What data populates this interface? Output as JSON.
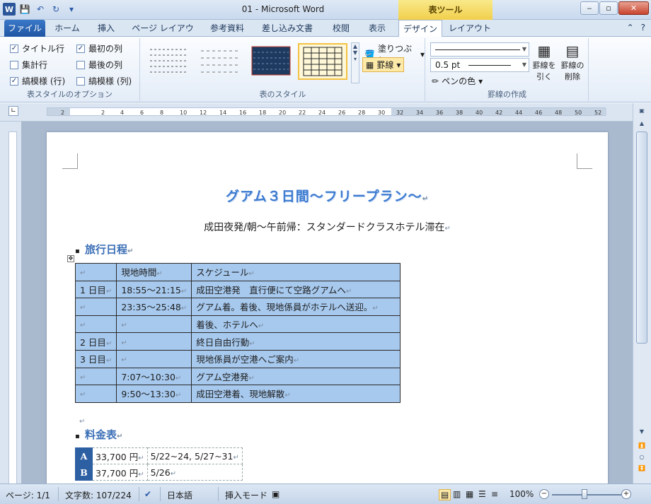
{
  "window": {
    "title": "01 - Microsoft Word",
    "contextual_tab": "表ツール",
    "controls": {
      "minimize": "‒",
      "restore": "▫",
      "close": "✕"
    }
  },
  "qat": {
    "word_logo": "W",
    "icons": [
      "save-icon",
      "undo-icon",
      "redo-icon",
      "customize-icon"
    ]
  },
  "tabs": [
    "ファイル",
    "ホーム",
    "挿入",
    "ページ レイアウト",
    "参考資料",
    "差し込み文書",
    "校閲",
    "表示",
    "デザイン",
    "レイアウト"
  ],
  "ribbon": {
    "options_group": {
      "label": "表スタイルのオプション",
      "checks": [
        {
          "label": "タイトル行",
          "checked": true
        },
        {
          "label": "最初の列",
          "checked": true
        },
        {
          "label": "集計行",
          "checked": false
        },
        {
          "label": "最後の列",
          "checked": false
        },
        {
          "label": "縞模様 (行)",
          "checked": true
        },
        {
          "label": "縞模様 (列)",
          "checked": false
        }
      ]
    },
    "styles_group": {
      "label": "表のスタイル",
      "shading": "塗りつぶし",
      "borders": "罫線"
    },
    "borders_group": {
      "label": "罫線の作成",
      "line_weight": "0.5 pt",
      "pen_color": "ペンの色",
      "draw_table": "罫線を\n引く",
      "eraser": "罫線の\n削除"
    }
  },
  "ruler": {
    "ticks": [
      "2",
      "2",
      "4",
      "6",
      "8",
      "10",
      "12",
      "14",
      "16",
      "18",
      "20",
      "22",
      "24",
      "26",
      "28",
      "30",
      "32",
      "34",
      "36",
      "38",
      "40",
      "42",
      "44",
      "46",
      "48",
      "50",
      "52"
    ]
  },
  "document": {
    "heading": "グアム３日間～フリープラン～",
    "subtitle": "成田夜発/朝～午前帰：スタンダードクラスホテル滞在",
    "para_mark": "↵",
    "section_itinerary": "旅行日程",
    "itinerary": [
      [
        "",
        "現地時間",
        "スケジュール"
      ],
      [
        "1 日目",
        "18:55～21:15",
        "成田空港発　直行便にて空路グアムへ"
      ],
      [
        "",
        "23:35～25:48",
        "グアム着。着後、現地係員がホテルへ送迎。"
      ],
      [
        "",
        "",
        "着後、ホテルへ"
      ],
      [
        "2 日目",
        "",
        "終日自由行動"
      ],
      [
        "3 日目",
        "",
        "現地係員が空港へご案内"
      ],
      [
        "",
        "7:07～10:30",
        "グアム空港発"
      ],
      [
        "",
        "9:50～13:30",
        "成田空港着、現地解散"
      ]
    ],
    "section_pricing": "料金表",
    "pricing": [
      [
        "A",
        "33,700 円",
        "5/22~24, 5/27~31"
      ],
      [
        "B",
        "37,700 円",
        "5/26"
      ]
    ]
  },
  "statusbar": {
    "page": "ページ: 1/1",
    "words": "文字数: 107/224",
    "language": "日本語",
    "mode": "挿入モード",
    "zoom": "100%"
  },
  "colors": {
    "accent": "#2b579a",
    "table_fill": "#a7c9ee",
    "heading": "#3d7bd0",
    "code_cell": "#2d5fa3"
  }
}
